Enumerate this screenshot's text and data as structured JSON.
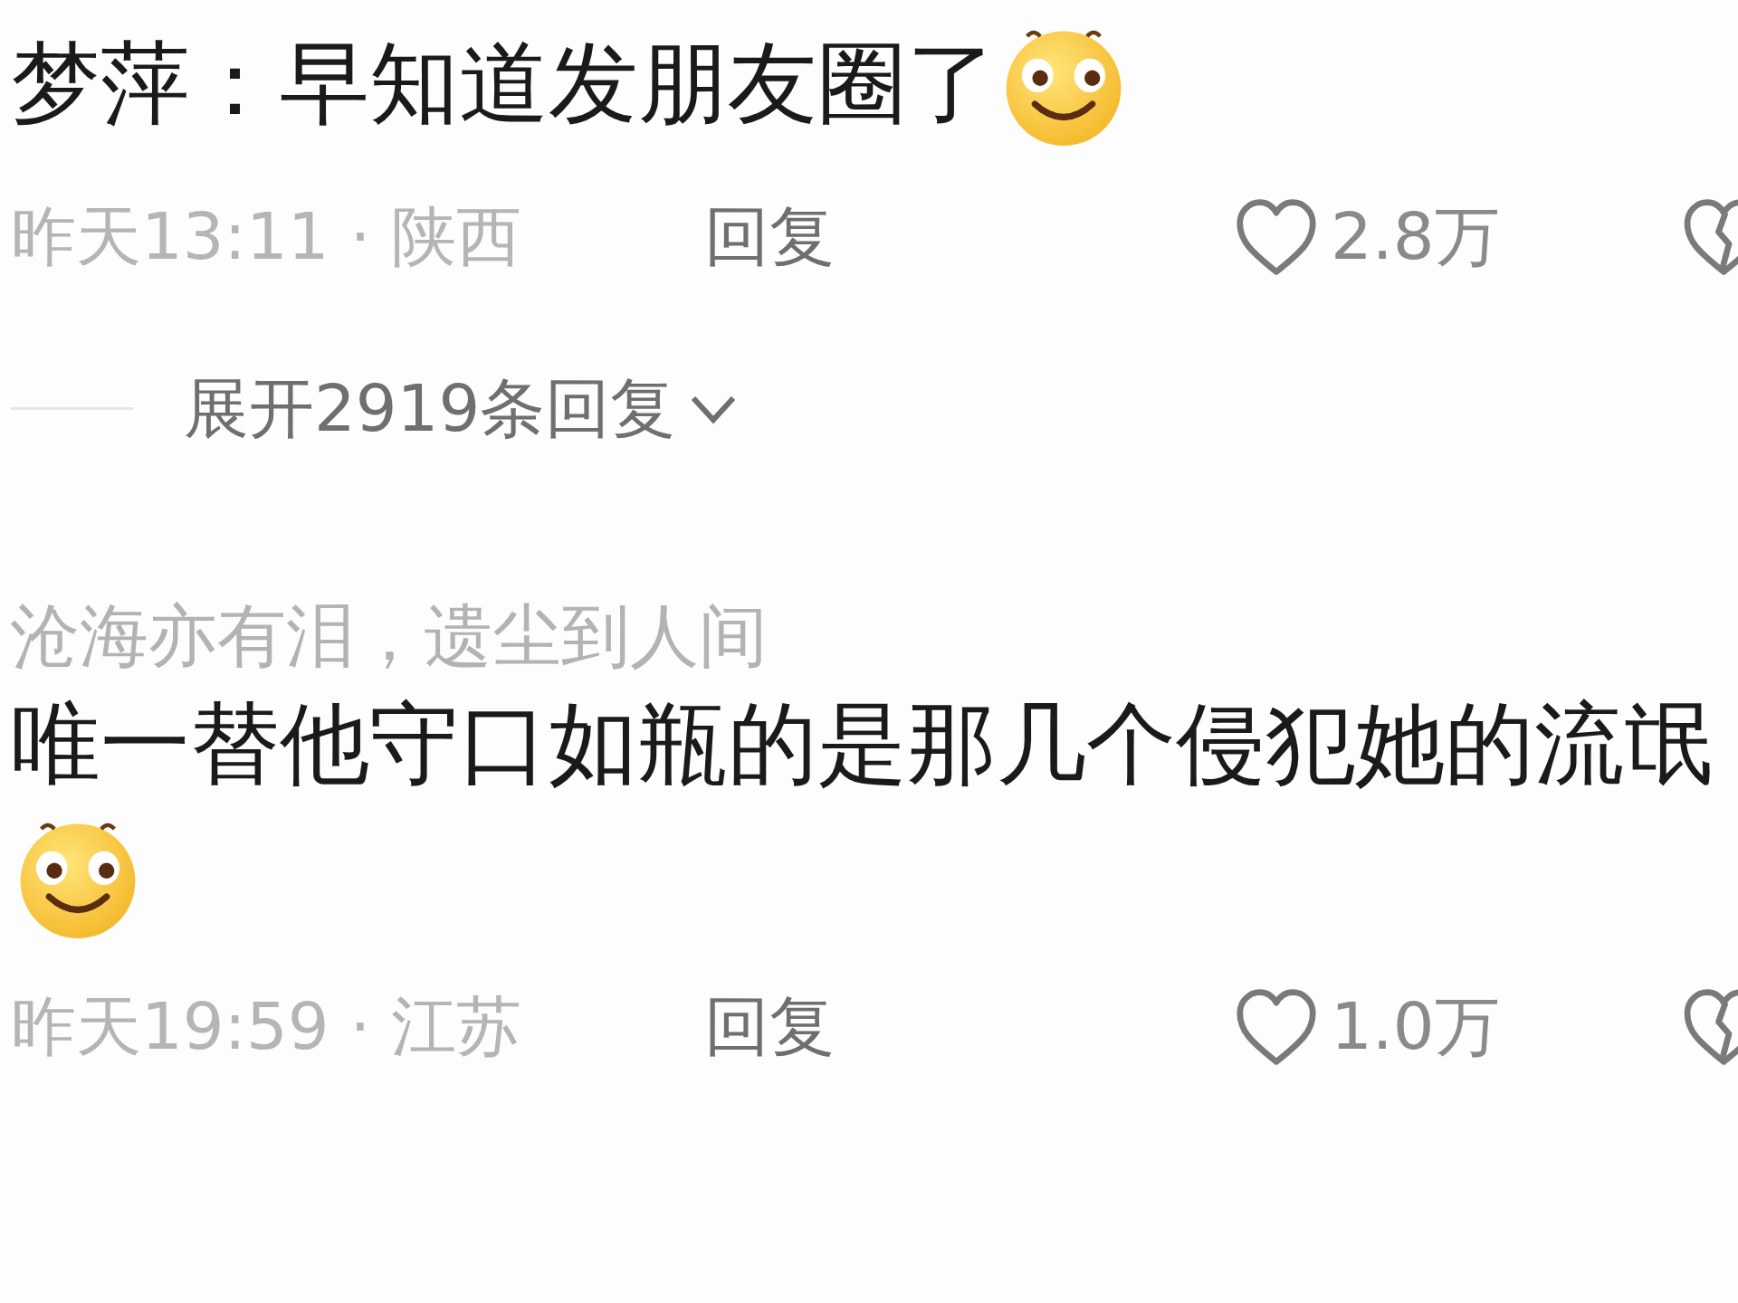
{
  "comments": [
    {
      "content": [
        {
          "kind": "text",
          "text": "梦萍：早知道发朋友圈了"
        },
        {
          "kind": "emoji"
        }
      ],
      "time": "昨天13:11 · 陕西",
      "reply": "回复",
      "likes": "2.8万",
      "expand": "展开2919条回复"
    },
    {
      "username": "沧海亦有泪，遗尘到人间",
      "content": [
        {
          "kind": "text",
          "text": "唯一替他守口如瓶的是那几个侵犯她的流氓"
        },
        {
          "kind": "emoji"
        }
      ],
      "time": "昨天19:59 · 江苏",
      "reply": "回复",
      "likes": "1.0万"
    }
  ]
}
